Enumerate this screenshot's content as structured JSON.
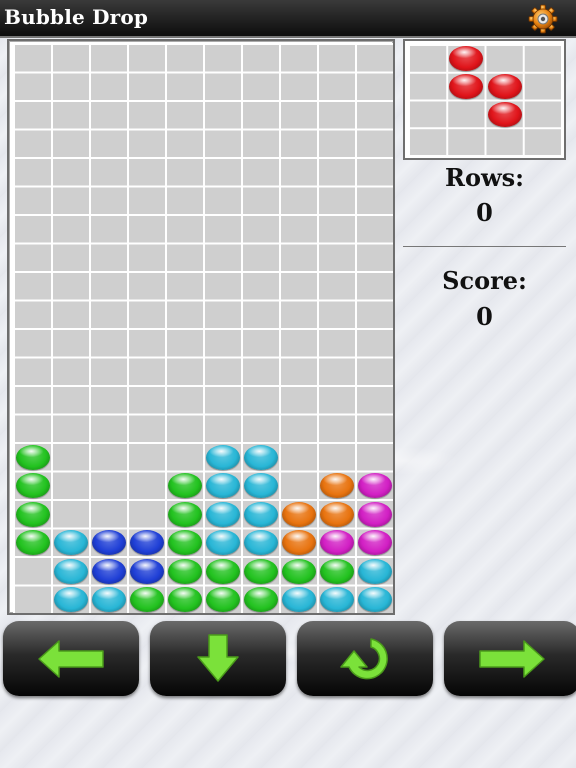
{
  "app": {
    "title": "Bubble Drop"
  },
  "stats": {
    "rows_label": "Rows:",
    "rows_value": "0",
    "score_label": "Score:",
    "score_value": "0"
  },
  "colors": {
    "green": "#22c21f",
    "cyan": "#28b6d6",
    "blue": "#1f3fd6",
    "orange": "#e8730f",
    "magenta": "#d21fc4",
    "red": "#e0141a",
    "button_arrow": "#7be13a"
  },
  "board": {
    "columns": 10,
    "rows": 20,
    "cells": [
      {
        "r": 14,
        "c": 0,
        "color": "green"
      },
      {
        "r": 14,
        "c": 5,
        "color": "cyan"
      },
      {
        "r": 14,
        "c": 6,
        "color": "cyan"
      },
      {
        "r": 15,
        "c": 0,
        "color": "green"
      },
      {
        "r": 15,
        "c": 4,
        "color": "green"
      },
      {
        "r": 15,
        "c": 5,
        "color": "cyan"
      },
      {
        "r": 15,
        "c": 6,
        "color": "cyan"
      },
      {
        "r": 15,
        "c": 8,
        "color": "orange"
      },
      {
        "r": 15,
        "c": 9,
        "color": "magenta"
      },
      {
        "r": 16,
        "c": 0,
        "color": "green"
      },
      {
        "r": 16,
        "c": 4,
        "color": "green"
      },
      {
        "r": 16,
        "c": 5,
        "color": "cyan"
      },
      {
        "r": 16,
        "c": 6,
        "color": "cyan"
      },
      {
        "r": 16,
        "c": 7,
        "color": "orange"
      },
      {
        "r": 16,
        "c": 8,
        "color": "orange"
      },
      {
        "r": 16,
        "c": 9,
        "color": "magenta"
      },
      {
        "r": 17,
        "c": 0,
        "color": "green"
      },
      {
        "r": 17,
        "c": 1,
        "color": "cyan"
      },
      {
        "r": 17,
        "c": 2,
        "color": "blue"
      },
      {
        "r": 17,
        "c": 3,
        "color": "blue"
      },
      {
        "r": 17,
        "c": 4,
        "color": "green"
      },
      {
        "r": 17,
        "c": 5,
        "color": "cyan"
      },
      {
        "r": 17,
        "c": 6,
        "color": "cyan"
      },
      {
        "r": 17,
        "c": 7,
        "color": "orange"
      },
      {
        "r": 17,
        "c": 8,
        "color": "magenta"
      },
      {
        "r": 17,
        "c": 9,
        "color": "magenta"
      },
      {
        "r": 18,
        "c": 1,
        "color": "cyan"
      },
      {
        "r": 18,
        "c": 2,
        "color": "blue"
      },
      {
        "r": 18,
        "c": 3,
        "color": "blue"
      },
      {
        "r": 18,
        "c": 4,
        "color": "green"
      },
      {
        "r": 18,
        "c": 5,
        "color": "green"
      },
      {
        "r": 18,
        "c": 6,
        "color": "green"
      },
      {
        "r": 18,
        "c": 7,
        "color": "green"
      },
      {
        "r": 18,
        "c": 8,
        "color": "green"
      },
      {
        "r": 18,
        "c": 9,
        "color": "cyan"
      },
      {
        "r": 19,
        "c": 1,
        "color": "cyan"
      },
      {
        "r": 19,
        "c": 2,
        "color": "cyan"
      },
      {
        "r": 19,
        "c": 3,
        "color": "green"
      },
      {
        "r": 19,
        "c": 4,
        "color": "green"
      },
      {
        "r": 19,
        "c": 5,
        "color": "green"
      },
      {
        "r": 19,
        "c": 6,
        "color": "green"
      },
      {
        "r": 19,
        "c": 7,
        "color": "cyan"
      },
      {
        "r": 19,
        "c": 8,
        "color": "cyan"
      },
      {
        "r": 19,
        "c": 9,
        "color": "cyan"
      }
    ]
  },
  "next_piece": {
    "columns": 4,
    "rows": 4,
    "cells": [
      {
        "r": 0,
        "c": 1,
        "color": "red"
      },
      {
        "r": 1,
        "c": 1,
        "color": "red"
      },
      {
        "r": 1,
        "c": 2,
        "color": "red"
      },
      {
        "r": 2,
        "c": 2,
        "color": "red"
      }
    ]
  },
  "controls": [
    {
      "name": "move-left-button",
      "icon": "arrow-left-icon"
    },
    {
      "name": "drop-down-button",
      "icon": "arrow-down-icon"
    },
    {
      "name": "rotate-button",
      "icon": "rotate-icon"
    },
    {
      "name": "move-right-button",
      "icon": "arrow-right-icon"
    }
  ],
  "icons": {
    "settings": "gear-icon"
  }
}
